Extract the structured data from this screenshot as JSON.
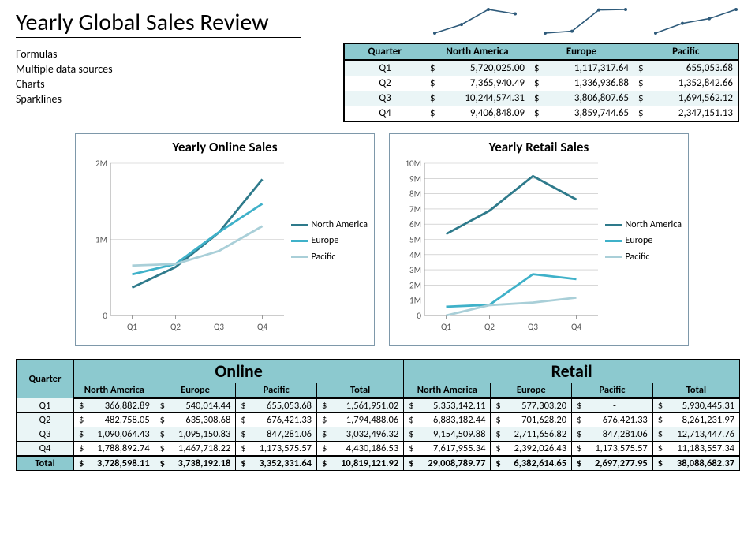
{
  "title": "Yearly Global Sales Review",
  "bullets": [
    "Formulas",
    "Multiple data sources",
    "Charts",
    "Sparklines"
  ],
  "summary_table": {
    "headers": [
      "Quarter",
      "North America",
      "Europe",
      "Pacific"
    ],
    "rows": [
      {
        "q": "Q1",
        "na": "5,720,025.00",
        "eu": "1,117,317.64",
        "pa": "655,053.68"
      },
      {
        "q": "Q2",
        "na": "7,365,940.49",
        "eu": "1,336,936.88",
        "pa": "1,352,842.66"
      },
      {
        "q": "Q3",
        "na": "10,244,574.31",
        "eu": "3,806,807.65",
        "pa": "1,694,562.12"
      },
      {
        "q": "Q4",
        "na": "9,406,848.09",
        "eu": "3,859,744.65",
        "pa": "2,347,151.13"
      }
    ]
  },
  "chart_data": [
    {
      "type": "line",
      "title": "Yearly Online Sales",
      "categories": [
        "Q1",
        "Q2",
        "Q3",
        "Q4"
      ],
      "ylabel": "",
      "yticks": [
        "0",
        "1M",
        "2M"
      ],
      "ylim": [
        0,
        2000000
      ],
      "series": [
        {
          "name": "North America",
          "color": "#2e7a8b",
          "values": [
            366882.89,
            635308.68,
            1090064.43,
            1788892.74
          ]
        },
        {
          "name": "Europe",
          "color": "#3fb1c9",
          "values": [
            540014.44,
            676421.33,
            1095150.83,
            1467718.22
          ]
        },
        {
          "name": "Pacific",
          "color": "#a9cfd8",
          "values": [
            655053.68,
            676421.33,
            847281.06,
            1173575.57
          ]
        }
      ],
      "legend": [
        "North America",
        "Europe",
        "Pacific"
      ]
    },
    {
      "type": "line",
      "title": "Yearly Retail Sales",
      "categories": [
        "Q1",
        "Q2",
        "Q3",
        "Q4"
      ],
      "ylabel": "",
      "yticks": [
        "0",
        "1M",
        "2M",
        "3M",
        "4M",
        "5M",
        "6M",
        "7M",
        "8M",
        "9M",
        "10M"
      ],
      "ylim": [
        0,
        10000000
      ],
      "series": [
        {
          "name": "North America",
          "color": "#2e7a8b",
          "values": [
            5353142.11,
            6883182.44,
            9154509.88,
            7617955.34
          ]
        },
        {
          "name": "Europe",
          "color": "#3fb1c9",
          "values": [
            577303.2,
            701628.2,
            2711656.82,
            2392026.43
          ]
        },
        {
          "name": "Pacific",
          "color": "#a9cfd8",
          "values": [
            0,
            676421.33,
            847281.06,
            1173575.57
          ]
        }
      ],
      "legend": [
        "North America",
        "Europe",
        "Pacific"
      ]
    }
  ],
  "big_table": {
    "quarter_header": "Quarter",
    "groups": [
      "Online",
      "Retail"
    ],
    "sub_headers": [
      "North America",
      "Europe",
      "Pacific",
      "Total"
    ],
    "rows": [
      {
        "q": "Q1",
        "online": [
          "366,882.89",
          "540,014.44",
          "655,053.68",
          "1,561,951.02"
        ],
        "retail": [
          "5,353,142.11",
          "577,303.20",
          "-",
          "5,930,445.31"
        ]
      },
      {
        "q": "Q2",
        "online": [
          "482,758.05",
          "635,308.68",
          "676,421.33",
          "1,794,488.06"
        ],
        "retail": [
          "6,883,182.44",
          "701,628.20",
          "676,421.33",
          "8,261,231.97"
        ]
      },
      {
        "q": "Q3",
        "online": [
          "1,090,064.43",
          "1,095,150.83",
          "847,281.06",
          "3,032,496.32"
        ],
        "retail": [
          "9,154,509.88",
          "2,711,656.82",
          "847,281.06",
          "12,713,447.76"
        ]
      },
      {
        "q": "Q4",
        "online": [
          "1,788,892.74",
          "1,467,718.22",
          "1,173,575.57",
          "4,430,186.53"
        ],
        "retail": [
          "7,617,955.34",
          "2,392,026.43",
          "1,173,575.57",
          "11,183,557.34"
        ]
      }
    ],
    "total_label": "Total",
    "total": {
      "online": [
        "3,728,598.11",
        "3,738,192.18",
        "3,352,331.64",
        "10,819,121.92"
      ],
      "retail": [
        "29,008,789.77",
        "6,382,614.65",
        "2,697,277.95",
        "38,088,682.37"
      ]
    }
  },
  "sparklines": [
    [
      5720025,
      7365940,
      10244574,
      9406848
    ],
    [
      1117317,
      1336936,
      3806807,
      3859744
    ],
    [
      655053,
      1352842,
      1694562,
      2347151
    ]
  ]
}
